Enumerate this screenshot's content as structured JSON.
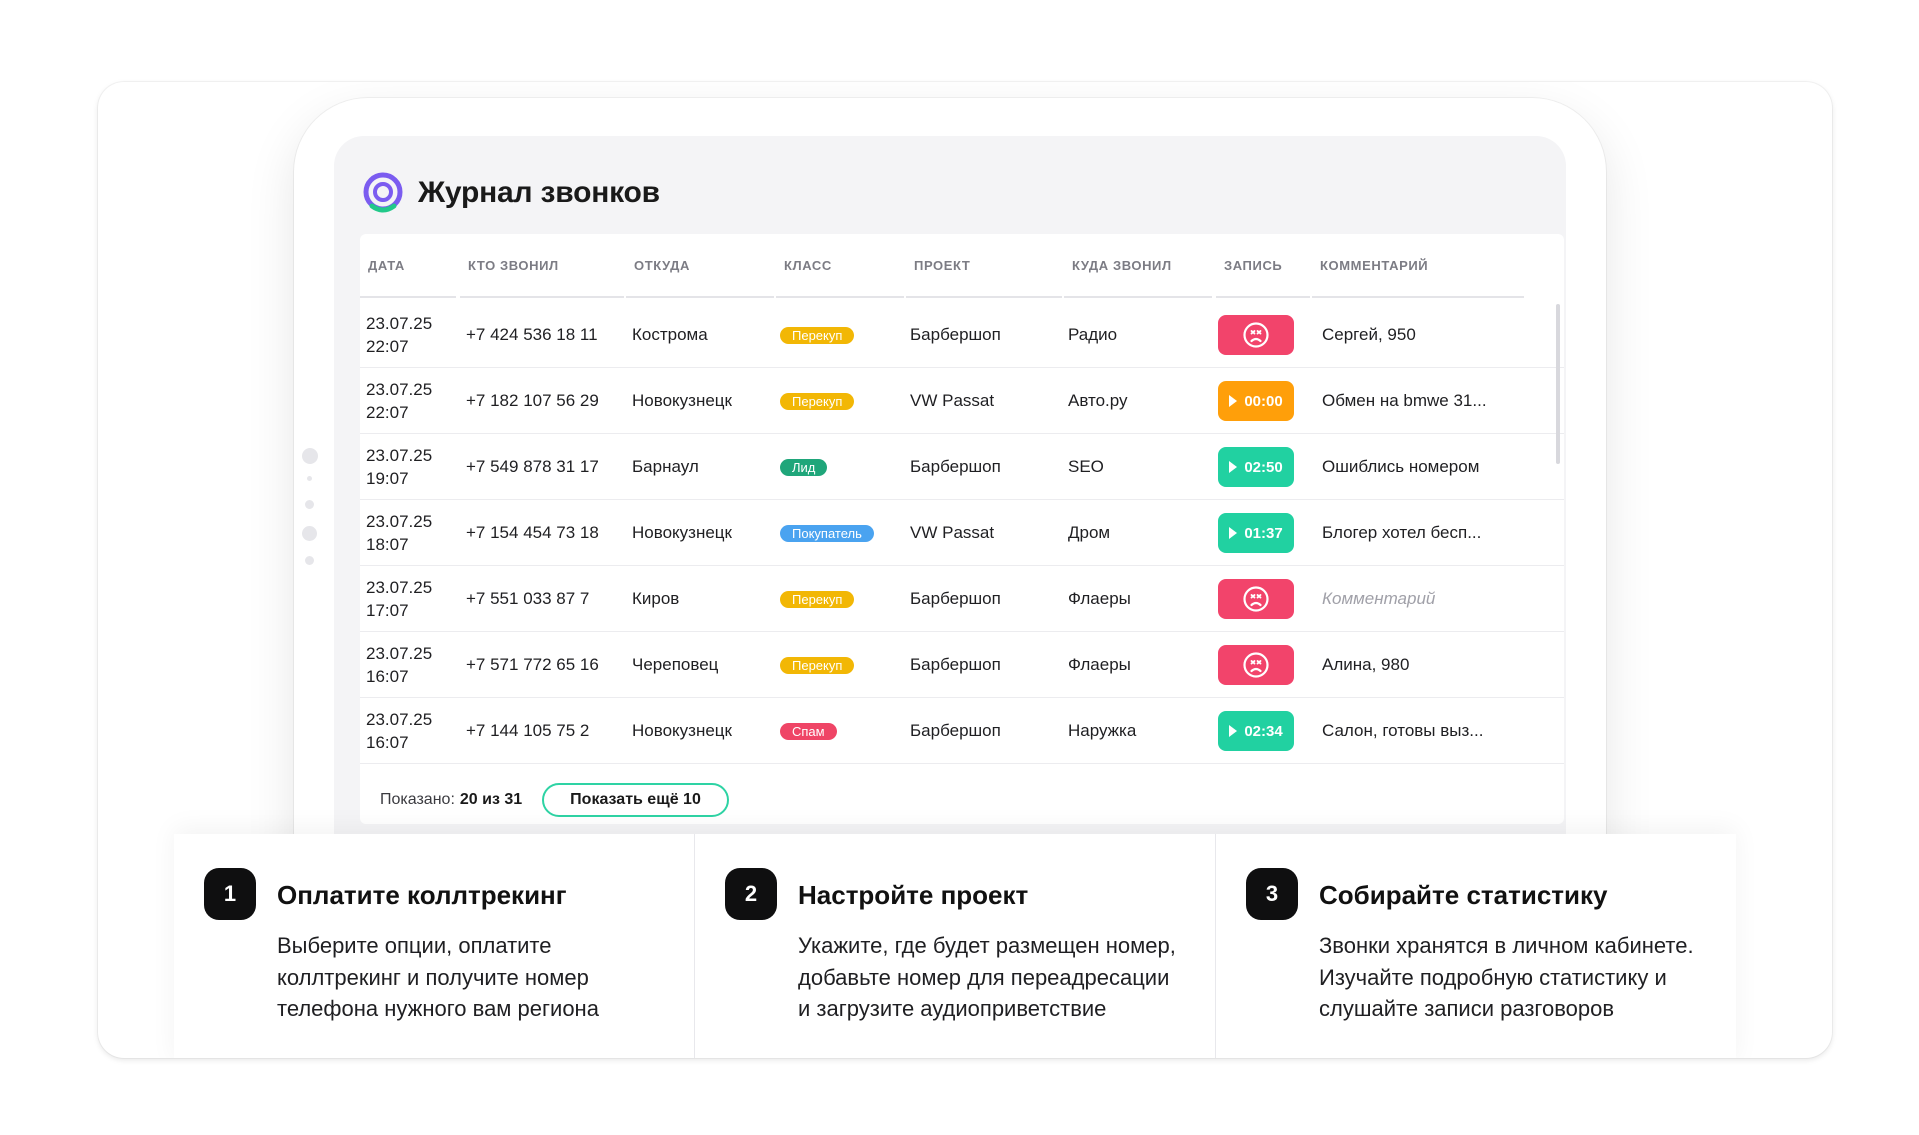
{
  "page": {
    "title": "Журнал звонков"
  },
  "table": {
    "columns": [
      "ДАТА",
      "КТО ЗВОНИЛ",
      "ОТКУДА",
      "КЛАСС",
      "ПРОЕКТ",
      "КУДА ЗВОНИЛ",
      "ЗАПИСЬ",
      "КОММЕНТАРИЙ"
    ],
    "rows": [
      {
        "date": "23.07.25\n22:07",
        "phone": "+7 424 536 18 11",
        "city": "Кострома",
        "class": "Перекуп",
        "class_color": "#f2b705",
        "project": "Барбершоп",
        "source": "Радио",
        "record": {
          "type": "missed",
          "color": "#f2446b",
          "icon": "sad-face-icon"
        },
        "comment": "Сергей, 950",
        "comment_placeholder": false
      },
      {
        "date": "23.07.25\n22:07",
        "phone": "+7 182 107 56 29",
        "city": "Новокузнецк",
        "class": "Перекуп",
        "class_color": "#f2b705",
        "project": "VW Passat",
        "source": "Авто.ру",
        "record": {
          "type": "audio",
          "color": "#ff9f0a",
          "duration": "00:00",
          "icon": "play-icon"
        },
        "comment": "Обмен на bmwe 31...",
        "comment_placeholder": false
      },
      {
        "date": "23.07.25\n19:07",
        "phone": "+7 549 878 31 17",
        "city": "Барнаул",
        "class": "Лид",
        "class_color": "#1fa67a",
        "project": "Барбершоп",
        "source": "SEO",
        "record": {
          "type": "audio",
          "color": "#21d1a1",
          "duration": "02:50",
          "icon": "play-icon"
        },
        "comment": "Ошиблись номером",
        "comment_placeholder": false
      },
      {
        "date": "23.07.25\n18:07",
        "phone": "+7 154 454 73 18",
        "city": "Новокузнецк",
        "class": "Покупатель",
        "class_color": "#4aa3f0",
        "project": "VW Passat",
        "source": "Дром",
        "record": {
          "type": "audio",
          "color": "#21d1a1",
          "duration": "01:37",
          "icon": "play-icon"
        },
        "comment": "Блогер хотел бесп...",
        "comment_placeholder": false
      },
      {
        "date": "23.07.25\n17:07",
        "phone": "+7 551 033 87 7",
        "city": "Киров",
        "class": "Перекуп",
        "class_color": "#f2b705",
        "project": "Барбершоп",
        "source": "Флаеры",
        "record": {
          "type": "missed",
          "color": "#f2446b",
          "icon": "sad-face-icon"
        },
        "comment": "Комментарий",
        "comment_placeholder": true
      },
      {
        "date": "23.07.25\n16:07",
        "phone": "+7 571 772 65 16",
        "city": "Череповец",
        "class": "Перекуп",
        "class_color": "#f2b705",
        "project": "Барбершоп",
        "source": "Флаеры",
        "record": {
          "type": "missed",
          "color": "#f2446b",
          "icon": "sad-face-icon"
        },
        "comment": "Алина, 980",
        "comment_placeholder": false
      },
      {
        "date": "23.07.25\n16:07",
        "phone": "+7 144 105 75 2",
        "city": "Новокузнецк",
        "class": "Спам",
        "class_color": "#ef4566",
        "project": "Барбершоп",
        "source": "Наружка",
        "record": {
          "type": "audio",
          "color": "#21d1a1",
          "duration": "02:34",
          "icon": "play-icon"
        },
        "comment": "Салон, готовы выз...",
        "comment_placeholder": false
      }
    ]
  },
  "pagination": {
    "shown_label": "Показано:",
    "shown_value": "20 из 31",
    "more_button": "Показать ещё 10"
  },
  "steps": [
    {
      "num": "1",
      "title": "Оплатите коллтрекинг",
      "text": "Выберите опции, оплатите коллтрекинг и получите номер телефона нужного вам региона"
    },
    {
      "num": "2",
      "title": "Настройте проект",
      "text": "Укажите, где будет размещен номер, добавьте номер для переадресации и загрузите аудиоприветствие"
    },
    {
      "num": "3",
      "title": "Собирайте статистику",
      "text": "Звонки хранятся в личном кабинете. Изучайте подробную статистику и слушайте записи разговоров"
    }
  ],
  "colors": {
    "accent_green": "#2ed3a4",
    "logo_purple": "#7b5cf0",
    "logo_green": "#22c98a"
  }
}
